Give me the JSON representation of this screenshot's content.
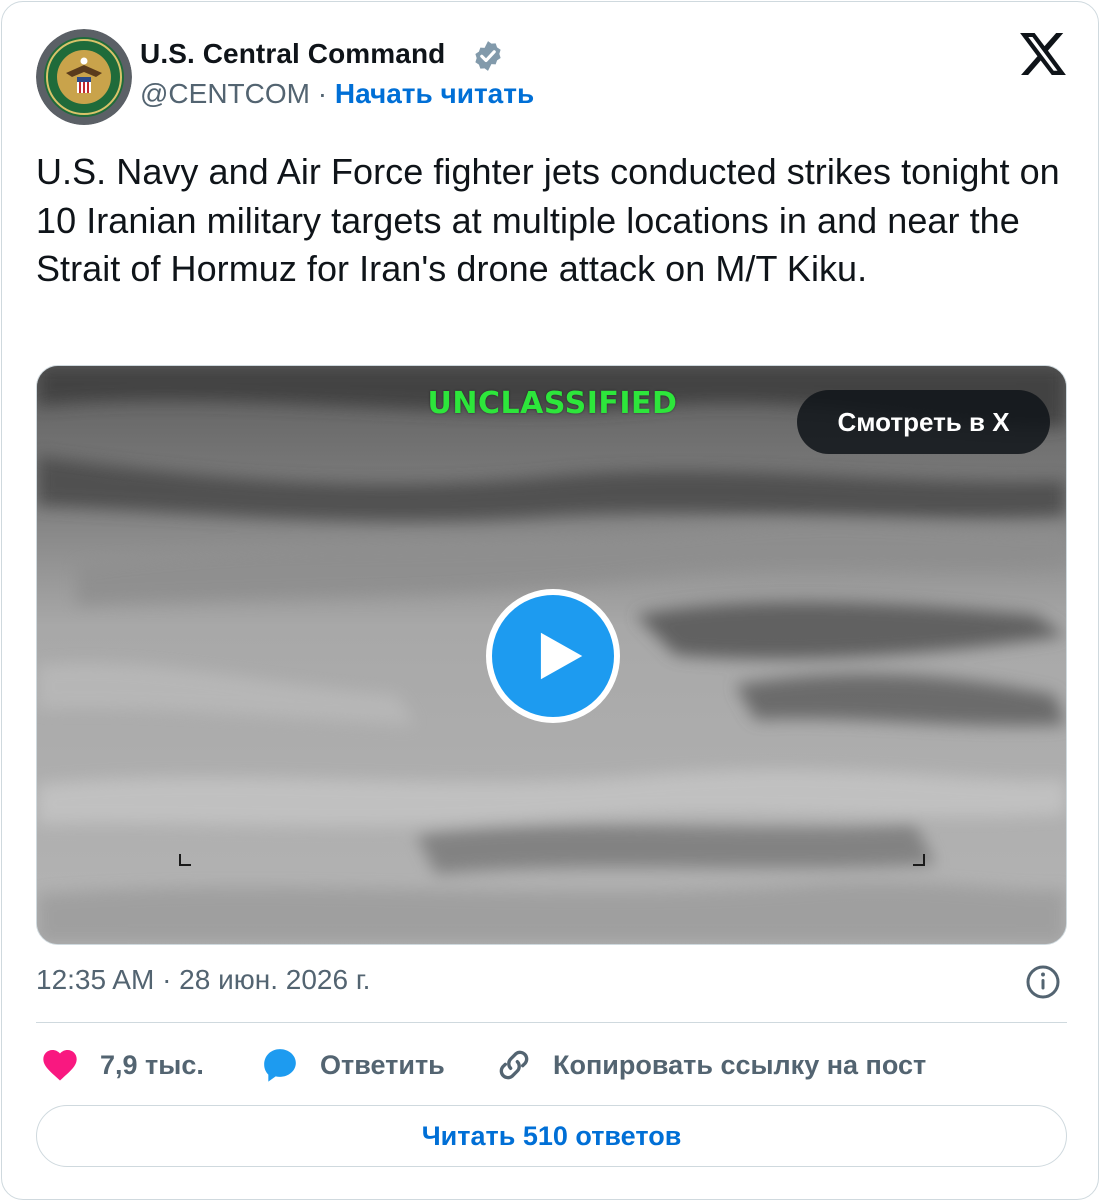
{
  "author": {
    "name": "U.S. Central Command",
    "handle": "@CENTCOM",
    "separator": "·",
    "follow_label": "Начать читать",
    "verified": true,
    "avatar_icon": "centcom-seal-icon"
  },
  "platform_icon": "x-logo-icon",
  "tweet": {
    "text": "U.S. Navy and Air Force fighter jets conducted strikes tonight on 10 Iranian military targets at multiple locations in and near the Strait of Hormuz for Iran's drone attack on M/T Kiku."
  },
  "media": {
    "overlay_label": "UNCLASSIFIED",
    "watch_label": "Смотреть в X",
    "play_icon": "play-icon"
  },
  "meta": {
    "timestamp": "12:35 AM · 28 июн. 2026 г.",
    "info_icon": "info-icon"
  },
  "actions": {
    "likes": "7,9 тыс.",
    "reply_label": "Ответить",
    "copy_link_label": "Копировать ссылку на пост"
  },
  "read_replies_label": "Читать 510 ответов",
  "colors": {
    "link_blue": "#006fd6",
    "play_blue": "#1d9bf0",
    "like_pink": "#f91880",
    "muted_gray": "#536471",
    "unclassified_green": "#2de63b"
  }
}
